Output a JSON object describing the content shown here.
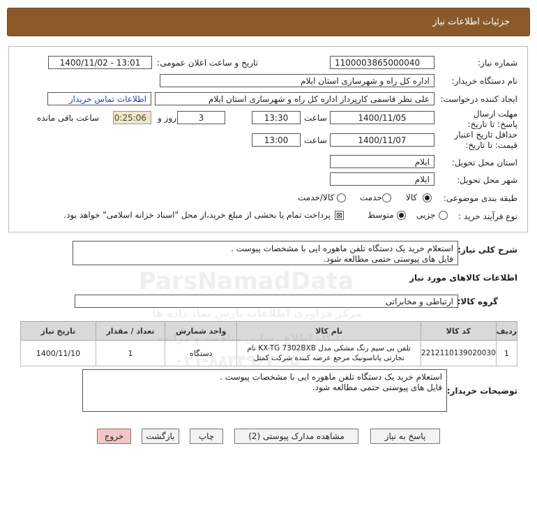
{
  "header": {
    "title": "جزئیات اطلاعات نیاز"
  },
  "fields": {
    "need_no_label": "شماره نیاز:",
    "need_no": "1100003865000040",
    "announce_label": "تاریخ و ساعت اعلان عمومی:",
    "announce_value": "1400/11/02 - 13:01",
    "buyer_org_label": "نام دستگاه خریدار:",
    "buyer_org": "اداره کل راه و شهرسازی استان ایلام",
    "requester_label": "ایجاد کننده درخواست:",
    "requester": "علی نظر قاسمی کارپرداز اداره کل راه و شهرسازی استان ایلام",
    "contact_link": "اطلاعات تماس خریدار",
    "deadline_label": "مهلت ارسال پاسخ: تا تاریخ:",
    "deadline_date": "1400/11/05",
    "time_label": "ساعت",
    "deadline_time": "13:30",
    "days_value": "3",
    "days_label": "روز و",
    "remaining_time": "00:25:06",
    "remaining_label": "ساعت باقی مانده",
    "validity_label": "حداقل تاریخ اعتبار قیمت: تا تاریخ:",
    "validity_date": "1400/11/07",
    "validity_time": "13:00",
    "province_label": "استان محل تحویل:",
    "province": "ایلام",
    "city_label": "شهر محل تحویل:",
    "city": "ایلام",
    "category_label": "طبقه بندی موضوعی:",
    "category_options": [
      "کالا",
      "خدمت",
      "کالا/خدمت"
    ],
    "purchase_type_label": "نوع فرآیند خرید :",
    "purchase_options": [
      "جزیی",
      "متوسط"
    ],
    "payment_note": "پرداخت تمام یا بخشی از مبلغ خرید،از محل \"اسناد خزانه اسلامی\" خواهد بود."
  },
  "description": {
    "label": "شرح کلی نیاز:",
    "text": "استعلام خرید یک دستگاه تلفن ماهوره ایی با مشخصات پیوست .\nفایل های پیوستی حتمی مطالعه شود."
  },
  "goods_section": {
    "title": "اطلاعات کالاهای مورد نیاز",
    "group_label": "گروه کالا:",
    "group_value": "ارتباطی و مخابراتی"
  },
  "table": {
    "headers": [
      "ردیف",
      "کد کالا",
      "نام کالا",
      "واحد شمارش",
      "تعداد / مقدار",
      "تاریخ نیاز"
    ],
    "rows": [
      {
        "index": "1",
        "code": "2212110139020030",
        "name": "تلفن بی سیم رنگ مشکی مدل KX-TG 7302BXB نام تجارتی پاناسونیک مرجع عرضه کننده شرکت کمتل",
        "unit": "دستگاه",
        "qty": "1",
        "date": "1400/11/10"
      }
    ]
  },
  "buyer_notes": {
    "label": "توضیحات خریدار:",
    "text": "استعلام خرید یک دستگاه تلفن ماهوره ایی با مشخصات پیوست .\nفایل های پیوستی حتمی مطالعه شود."
  },
  "buttons": {
    "reply": "پاسخ به نیاز",
    "docs": "مشاهده مدارک پیوستی (2)",
    "print": "چاپ",
    "back": "بازگشت",
    "exit": "خروج"
  },
  "watermark": {
    "brand": "ParsNamadData",
    "line_fa": "مرکز فرآوری اطلاعات پارس نماد داده ها",
    "line_fa2": "پایگاه اطلاع رسانی مناقصه و مزایده",
    "phone": "۰۲۱-۸۸۳۴۹۶۷۰-۵"
  },
  "colors": {
    "header_bg": "#8b5a2b",
    "link": "#1a47b8",
    "timer_bg": "#efe7c6",
    "exit_bg": "#f6c6c6"
  }
}
